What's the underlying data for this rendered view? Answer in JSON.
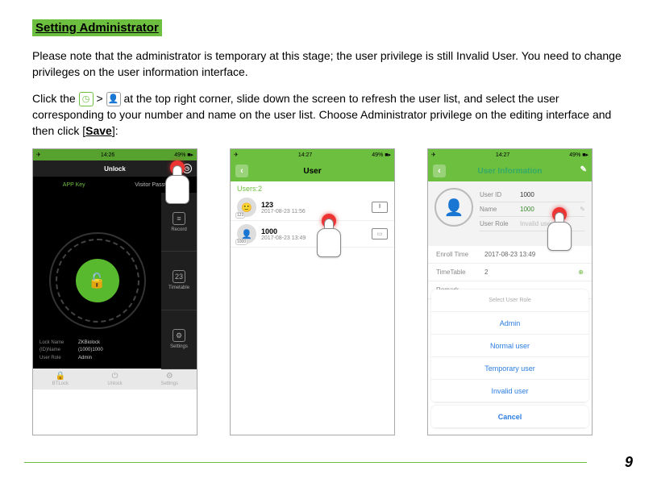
{
  "page": {
    "heading": "Setting Administrator",
    "para1": "Please note that the administrator is temporary at this stage; the user privilege is still Invalid User. You need to change privileges on the user information interface.",
    "para2a": "Click the ",
    "para2b": " > ",
    "para2c": " at the top right corner, slide down the screen to refresh the user list, and select the user corresponding to your number and name on the user list. Choose Administrator privilege on the editing interface and then click [",
    "para2d": "Save",
    "para2e": "]:",
    "number": "9"
  },
  "status": {
    "time1": "14:26",
    "time2": "14:27",
    "time3": "14:27",
    "batt": "49%"
  },
  "phone1": {
    "unlock": "Unlock",
    "tabs": {
      "app": "APP Key",
      "visitor": "Visitor Password"
    },
    "side": {
      "record": "Record",
      "timetable": "Timetable",
      "settings": "Settings"
    },
    "info": {
      "lockNameK": "Lock Name",
      "lockNameV": "ZKBiolock",
      "idNameK": "(ID)Name",
      "idNameV": "(1000)1000",
      "roleK": "User Role",
      "roleV": "Admin"
    },
    "footer": {
      "a": "BTLock",
      "b": "Unlock",
      "c": "Settings"
    }
  },
  "phone2": {
    "title": "User",
    "count": "Users:2",
    "rows": [
      {
        "id": "123",
        "name": "123",
        "date": "2017-08-23 11:56",
        "iconGlyph": "⦀"
      },
      {
        "id": "1000",
        "name": "1000",
        "date": "2017-08-23 13:49",
        "iconGlyph": "▭"
      }
    ]
  },
  "phone3": {
    "title": "User Information",
    "fields": {
      "idK": "User ID",
      "idV": "1000",
      "nameK": "Name",
      "nameV": "1000",
      "roleK": "User Role",
      "roleV": "Invalid user"
    },
    "body": {
      "enrollK": "Enroll Time",
      "enrollV": "2017-08-23 13:49",
      "ttK": "TimeTable",
      "ttV": "2",
      "remarkK": "Remark"
    },
    "sheet": {
      "title": "Select User Role",
      "opts": [
        "Admin",
        "Normal user",
        "Temporary user",
        "Invalid user"
      ],
      "cancel": "Cancel"
    }
  }
}
